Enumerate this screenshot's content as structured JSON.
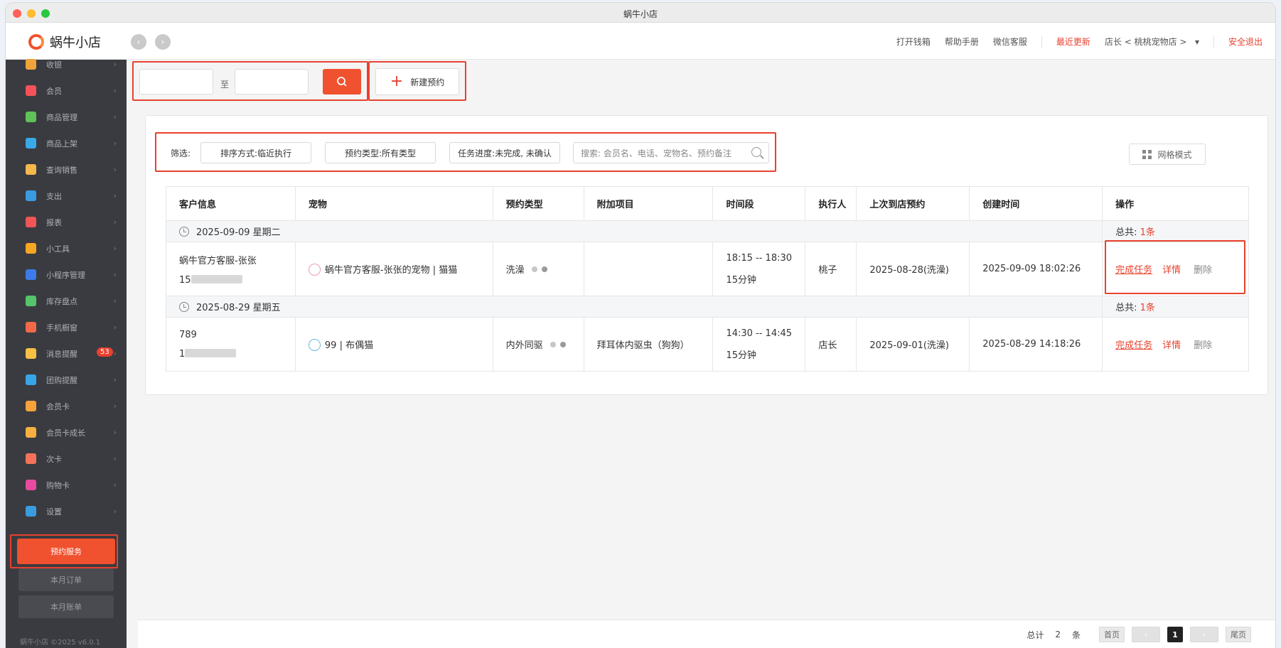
{
  "window_title": "蜗牛小店",
  "header": {
    "logo_text": "蜗牛小店",
    "links": [
      "打开钱箱",
      "帮助手册",
      "微信客服"
    ],
    "recent_update": "最近更新",
    "store_selector": "店长 < 桃桃宠物店 >",
    "logout": "安全退出"
  },
  "sidebar": {
    "items": [
      {
        "label": "收银",
        "color": "#f0a33a"
      },
      {
        "label": "会员",
        "color": "#f4525a"
      },
      {
        "label": "商品管理",
        "color": "#5fc35a"
      },
      {
        "label": "商品上架",
        "color": "#39a9e8"
      },
      {
        "label": "查询销售",
        "color": "#f5b84a"
      },
      {
        "label": "支出",
        "color": "#3a9be0"
      },
      {
        "label": "报表",
        "color": "#f05656"
      },
      {
        "label": "小工具",
        "color": "#f5a623"
      },
      {
        "label": "小程序管理",
        "color": "#3d7be8"
      },
      {
        "label": "库存盘点",
        "color": "#55c46b"
      },
      {
        "label": "手机橱窗",
        "color": "#f06a4a"
      },
      {
        "label": "消息提醒",
        "color": "#f5c043",
        "badge": "53"
      },
      {
        "label": "团购提醒",
        "color": "#37a6e8"
      },
      {
        "label": "会员卡",
        "color": "#f5a33a"
      },
      {
        "label": "会员卡成长",
        "color": "#f5b040"
      },
      {
        "label": "次卡",
        "color": "#f4725a"
      },
      {
        "label": "购物卡",
        "color": "#e84aa0"
      },
      {
        "label": "设置",
        "color": "#3a9be0"
      }
    ],
    "appointment_button": "预约服务",
    "monthly_orders": "本月订单",
    "monthly_billing": "本月账单",
    "footer": "蜗牛小店 ©2025 v6.0.1"
  },
  "toolbar": {
    "range_separator": "至",
    "start_date_value": "",
    "end_date_value": "",
    "new_appointment": "新建预约"
  },
  "filters": {
    "label": "筛选:",
    "sort": "排序方式:临近执行",
    "type": "预约类型:所有类型",
    "progress": "任务进度:未完成, 未确认",
    "search_placeholder": "搜索: 会员名、电话、宠物名、预约备注",
    "grid_mode": "网格模式"
  },
  "table": {
    "headers": [
      "客户信息",
      "宠物",
      "预约类型",
      "附加项目",
      "时间段",
      "执行人",
      "上次到店预约",
      "创建时间",
      "操作"
    ],
    "total_prefix": "总共:",
    "groups": [
      {
        "date": "2025-09-09 星期二",
        "total": "1条",
        "rows": [
          {
            "customer_name": "蜗牛官方客服-张张",
            "customer_phone": "15",
            "pet": "蜗牛官方客服-张张的宠物 | 猫猫",
            "pet_icon_color": "#e89bb8",
            "type": "洗澡",
            "extra": "",
            "time_range": "18:15 -- 18:30",
            "duration": "15分钟",
            "executor": "桃子",
            "last_visit": "2025-08-28(洗澡)",
            "created": "2025-09-09 18:02:26",
            "actions": {
              "complete": "完成任务",
              "detail": "详情",
              "delete": "删除"
            }
          }
        ]
      },
      {
        "date": "2025-08-29 星期五",
        "total": "1条",
        "rows": [
          {
            "customer_name": "789",
            "customer_phone": "1",
            "pet": "99 | 布偶猫",
            "pet_icon_color": "#6ab8e0",
            "type": "内外同驱",
            "extra": "拜耳体内驱虫（狗狗）",
            "time_range": "14:30 -- 14:45",
            "duration": "15分钟",
            "executor": "店长",
            "last_visit": "2025-09-01(洗澡)",
            "created": "2025-08-29 14:18:26",
            "actions": {
              "complete": "完成任务",
              "detail": "详情",
              "delete": "删除"
            }
          }
        ]
      }
    ]
  },
  "pagination": {
    "total_label": "总计",
    "total": "2",
    "unit": "条",
    "first": "首页",
    "current": "1",
    "last": "尾页"
  },
  "colors": {
    "accent": "#f0512e",
    "highlight_box": "#e8412e",
    "sidebar_bg": "#3a3b40"
  }
}
